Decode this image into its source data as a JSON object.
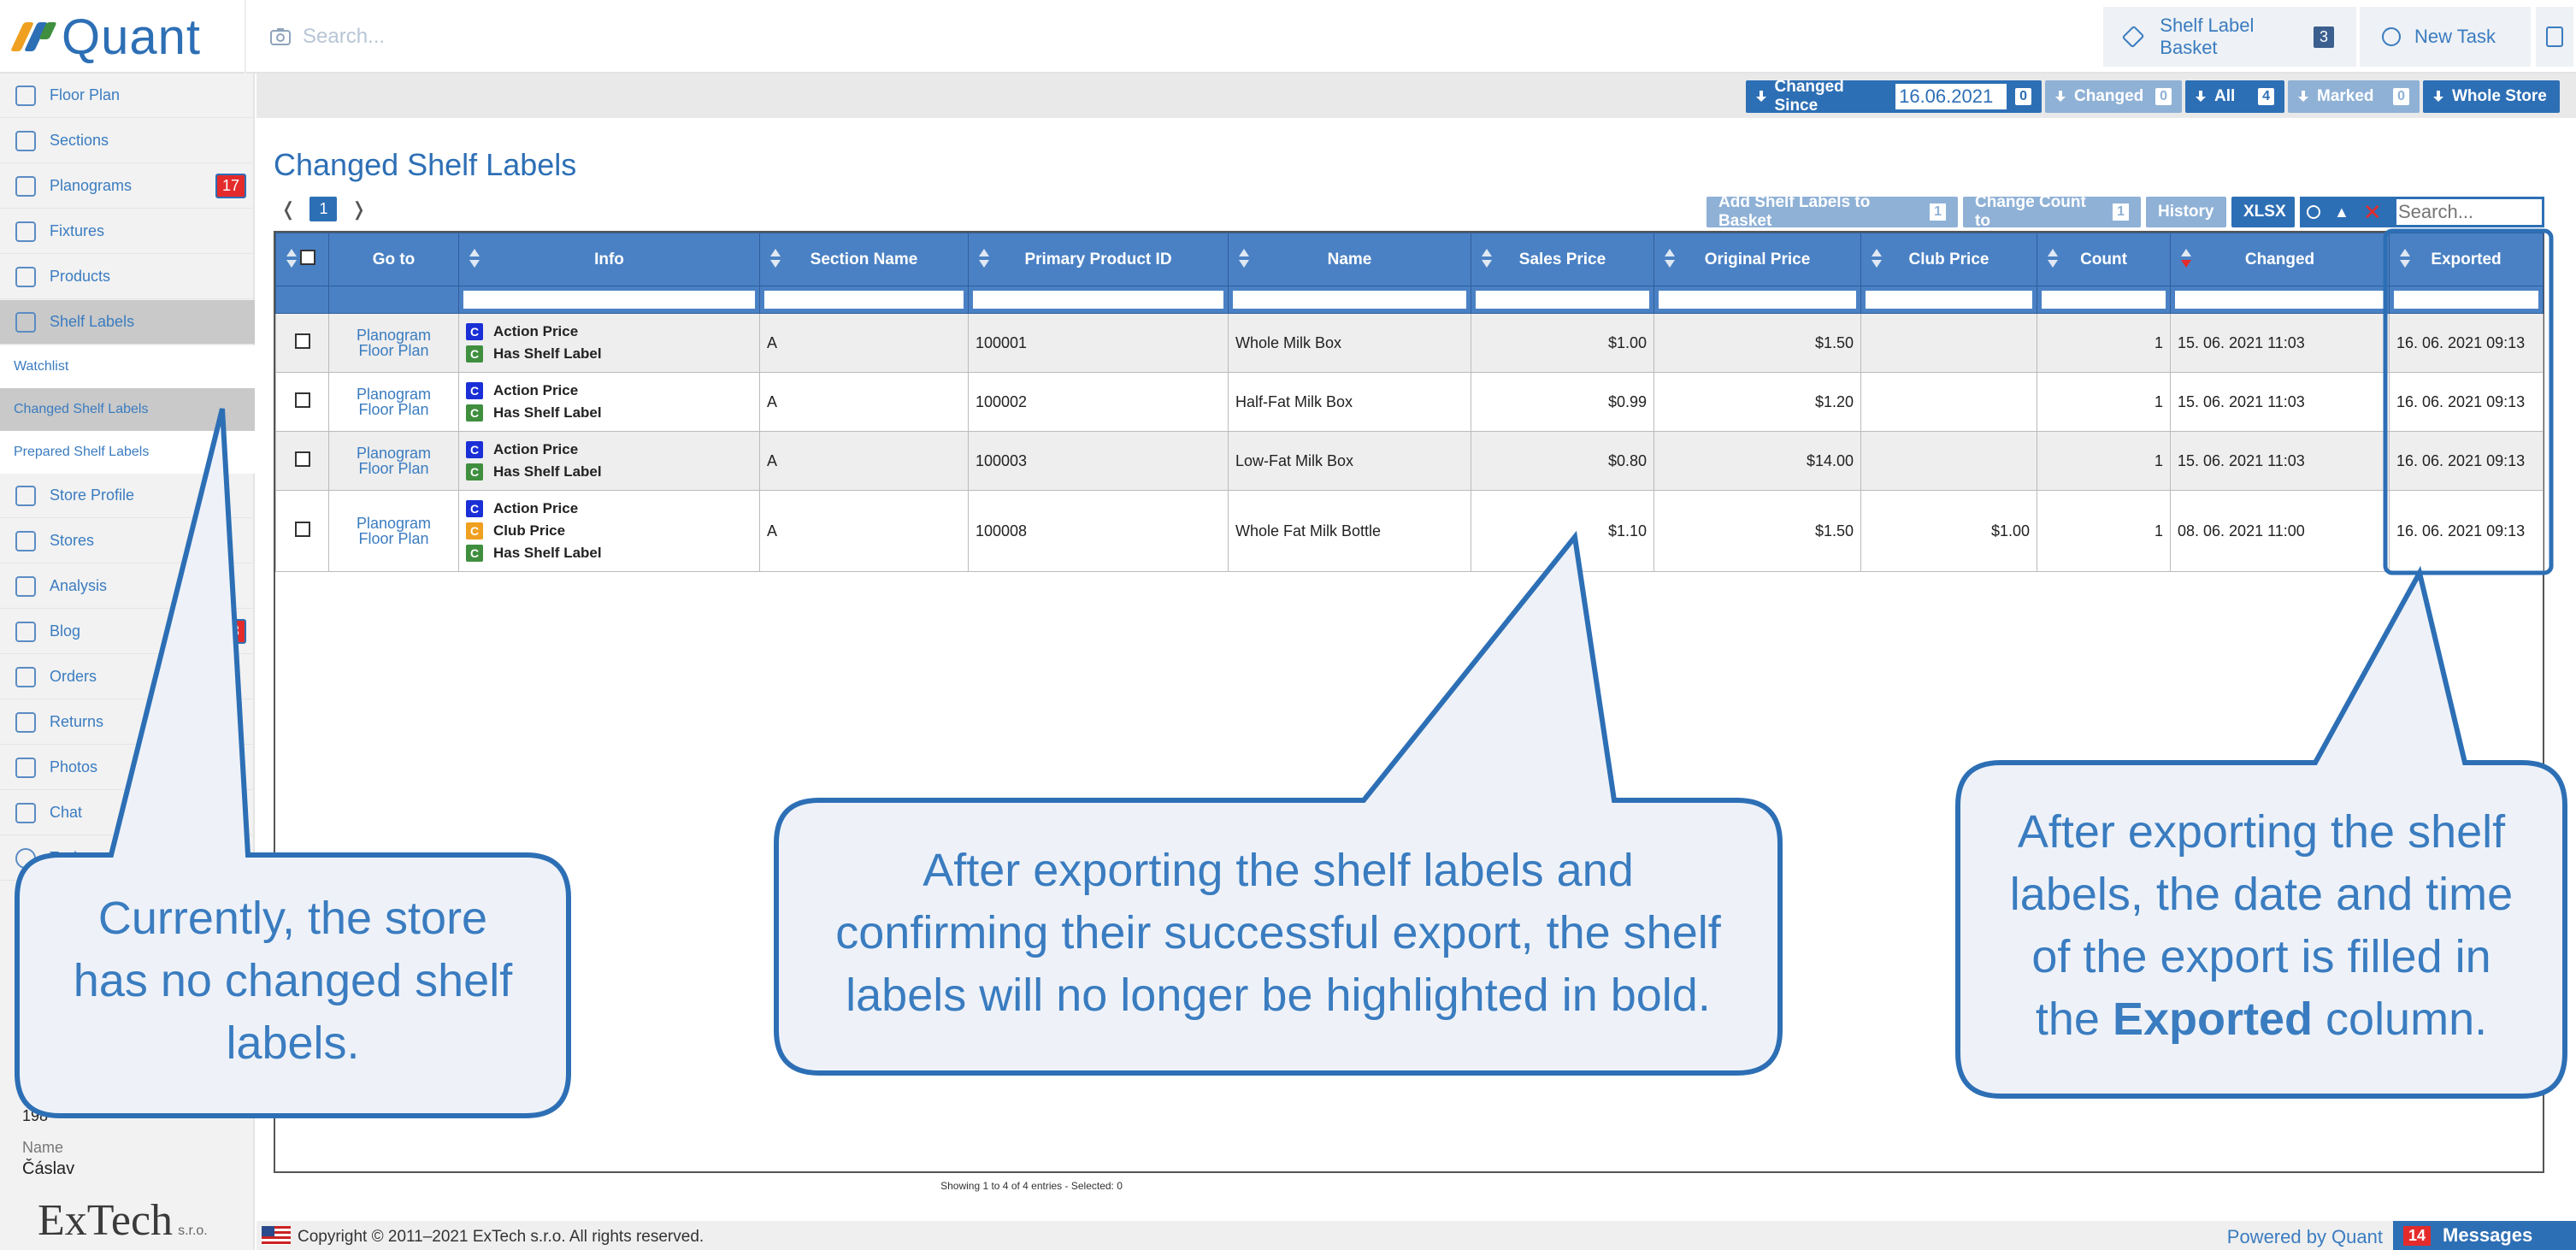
{
  "app": {
    "name": "Quant"
  },
  "topbar": {
    "search_placeholder": "Search...",
    "basket_label": "Shelf Label Basket",
    "basket_count": "3",
    "new_task_label": "New Task"
  },
  "subbar": {
    "changed_since_label": "Changed Since",
    "changed_since_date": "16.06.2021",
    "changed_since_count": "0",
    "changed_label": "Changed",
    "changed_count": "0",
    "all_label": "All",
    "all_count": "4",
    "marked_label": "Marked",
    "marked_count": "0",
    "whole_store_label": "Whole Store"
  },
  "sidebar": {
    "items": [
      {
        "label": "Floor Plan"
      },
      {
        "label": "Sections"
      },
      {
        "label": "Planograms",
        "badge": "17"
      },
      {
        "label": "Fixtures"
      },
      {
        "label": "Products"
      },
      {
        "label": "Shelf Labels"
      },
      {
        "label": "Store Profile"
      },
      {
        "label": "Stores"
      },
      {
        "label": "Analysis"
      },
      {
        "label": "Blog",
        "badge": "3"
      },
      {
        "label": "Orders"
      },
      {
        "label": "Returns"
      },
      {
        "label": "Photos"
      },
      {
        "label": "Chat"
      },
      {
        "label": "Tasks"
      }
    ],
    "sub_items": [
      {
        "label": "Watchlist"
      },
      {
        "label": "Changed Shelf Labels"
      },
      {
        "label": "Prepared Shelf Labels"
      }
    ],
    "store_number": "198",
    "name_label": "Name",
    "name_value": "Čáslav",
    "company_logo": "ExTech",
    "company_suffix": "s.r.o."
  },
  "main": {
    "title": "Changed Shelf Labels",
    "page": "1",
    "prev": "❬",
    "next": "❭",
    "actions": {
      "add_to_basket": "Add Shelf Labels to Basket",
      "add_count": "1",
      "change_count": "Change Count to",
      "change_count_value": "1",
      "history": "History",
      "xlsx": "XLSX",
      "search_placeholder": "Search..."
    },
    "columns": [
      "Go to",
      "Info",
      "Section Name",
      "Primary Product ID",
      "Name",
      "Sales Price",
      "Original Price",
      "Club Price",
      "Count",
      "Changed",
      "Exported"
    ],
    "goto_line1": "Planogram",
    "goto_line2": "Floor Plan",
    "tag_letter": "C",
    "rows": [
      {
        "tags": [
          "Action Price",
          "Has Shelf Label"
        ],
        "section": "A",
        "product_id": "100001",
        "name": "Whole Milk Box",
        "sales_price": "$1.00",
        "original_price": "$1.50",
        "club_price": "",
        "count": "1",
        "changed": "15. 06. 2021 11:03",
        "exported": "16. 06. 2021 09:13"
      },
      {
        "tags": [
          "Action Price",
          "Has Shelf Label"
        ],
        "section": "A",
        "product_id": "100002",
        "name": "Half-Fat Milk Box",
        "sales_price": "$0.99",
        "original_price": "$1.20",
        "club_price": "",
        "count": "1",
        "changed": "15. 06. 2021 11:03",
        "exported": "16. 06. 2021 09:13"
      },
      {
        "tags": [
          "Action Price",
          "Has Shelf Label"
        ],
        "section": "A",
        "product_id": "100003",
        "name": "Low-Fat Milk Box",
        "sales_price": "$0.80",
        "original_price": "$14.00",
        "club_price": "",
        "count": "1",
        "changed": "15. 06. 2021 11:03",
        "exported": "16. 06. 2021 09:13"
      },
      {
        "tags": [
          "Action Price",
          "Club Price",
          "Has Shelf Label"
        ],
        "section": "A",
        "product_id": "100008",
        "name": "Whole Fat Milk Bottle",
        "sales_price": "$1.10",
        "original_price": "$1.50",
        "club_price": "$1.00",
        "count": "1",
        "changed": "08. 06. 2021 11:00",
        "exported": "16. 06. 2021 09:13"
      }
    ],
    "footer_info": "Showing 1 to 4 of 4 entries - Selected: 0"
  },
  "footer": {
    "copyright": "Copyright © 2011–2021 ExTech s.r.o. All rights reserved.",
    "powered": "Powered by Quant",
    "messages_count": "14",
    "messages_label": "Messages"
  },
  "callouts": {
    "left": [
      "Currently, the store",
      "has no changed shelf",
      "labels."
    ],
    "middle": [
      "After exporting the shelf labels and",
      "confirming their successful export, the shelf",
      "labels will no longer be highlighted in bold."
    ],
    "right_line1": "After exporting the shelf",
    "right_line2": "labels, the date and time",
    "right_line3": "of the export is filled in",
    "right_line4_a": "the",
    "right_line4_bold": "Exported",
    "right_line4_b": "column."
  },
  "colors": {
    "accent": "#2d6fb5",
    "header": "#4a81c4",
    "badge": "#e42b2b",
    "tag_blue": "#1a2fd6",
    "tag_green": "#3f8f3f",
    "tag_orange": "#f0a020"
  }
}
